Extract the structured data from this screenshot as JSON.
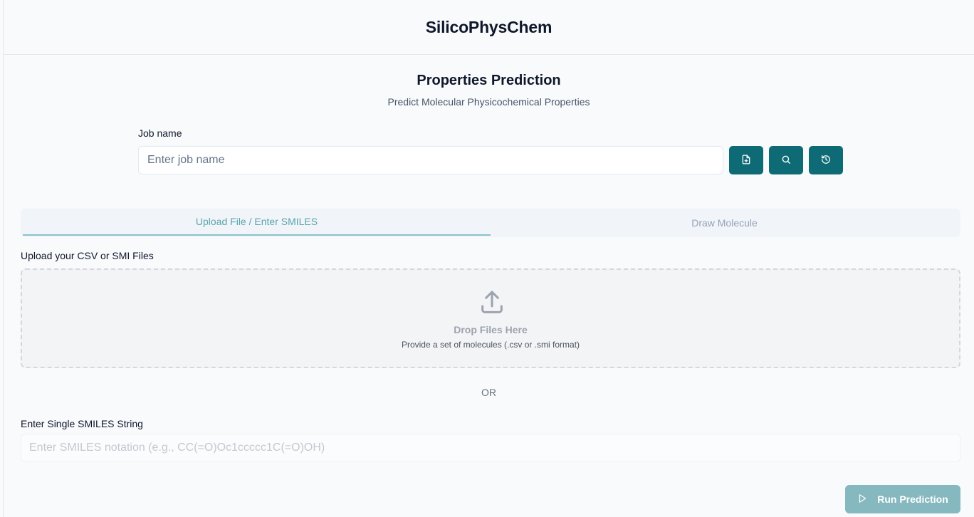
{
  "header": {
    "app_title": "SilicoPhysChem"
  },
  "page": {
    "title": "Properties Prediction",
    "subtitle": "Predict Molecular Physicochemical Properties"
  },
  "job": {
    "label": "Job name",
    "placeholder": "Enter job name",
    "value": "",
    "buttons": [
      {
        "icon": "file-plus-icon"
      },
      {
        "icon": "search-icon"
      },
      {
        "icon": "history-icon"
      }
    ]
  },
  "tabs": [
    {
      "label": "Upload File / Enter SMILES",
      "active": true
    },
    {
      "label": "Draw Molecule",
      "active": false
    }
  ],
  "upload": {
    "label": "Upload your CSV or SMI Files",
    "dropzone_title": "Drop Files Here",
    "dropzone_subtitle": "Provide a set of molecules (.csv or .smi format)",
    "icon": "upload-icon"
  },
  "or_text": "OR",
  "smiles": {
    "label": "Enter Single SMILES String",
    "placeholder": "Enter SMILES notation (e.g., CC(=O)Oc1ccccc1C(=O)OH)",
    "value": ""
  },
  "run_button": {
    "label": "Run Prediction",
    "icon": "play-icon",
    "enabled": false
  },
  "colors": {
    "accent": "#0e6b76",
    "accent_disabled": "#86b8bf",
    "tab_active_text": "#5ba4ae",
    "background": "#f8fafc"
  }
}
